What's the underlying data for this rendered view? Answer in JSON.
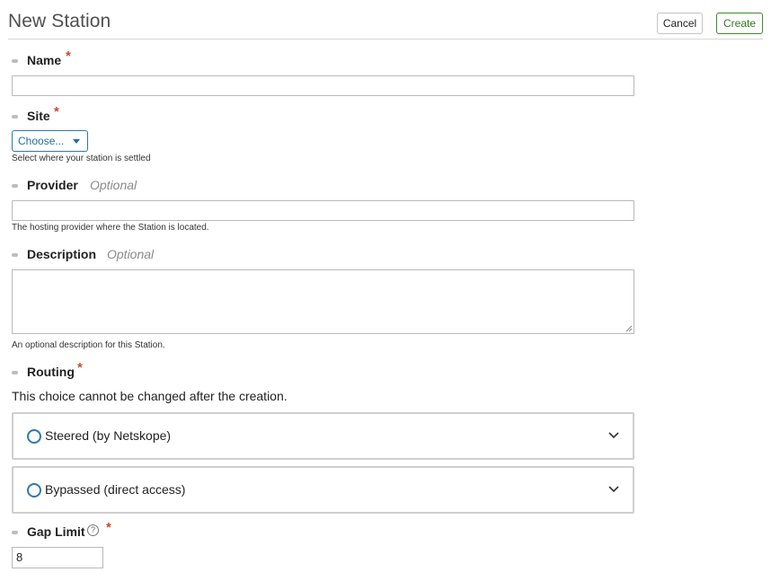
{
  "header": {
    "title": "New Station",
    "cancel_label": "Cancel",
    "create_label": "Create"
  },
  "fields": {
    "name": {
      "label": "Name",
      "required_mark": "*",
      "value": ""
    },
    "site": {
      "label": "Site",
      "required_mark": "*",
      "selected": "Choose...",
      "help": "Select where your station is settled"
    },
    "provider": {
      "label": "Provider",
      "optional": "Optional",
      "value": "",
      "help": "The hosting provider where the Station is located."
    },
    "description": {
      "label": "Description",
      "optional": "Optional",
      "value": "",
      "help": "An optional description for this Station."
    },
    "routing": {
      "label": "Routing",
      "required_mark": "*",
      "note": "This choice cannot be changed after the creation.",
      "options": [
        {
          "label": "Steered (by Netskope)",
          "icon": "chevron-down-icon"
        },
        {
          "label": "Bypassed (direct access)",
          "icon": "chevron-down-icon"
        }
      ]
    },
    "gap_limit": {
      "label": "Gap Limit",
      "required_mark": "*",
      "help_icon": "?",
      "value": "8"
    }
  },
  "colors": {
    "required": "#cc4b2a",
    "primary_blue": "#2a7ab0",
    "create_green": "#2f7a1e"
  }
}
